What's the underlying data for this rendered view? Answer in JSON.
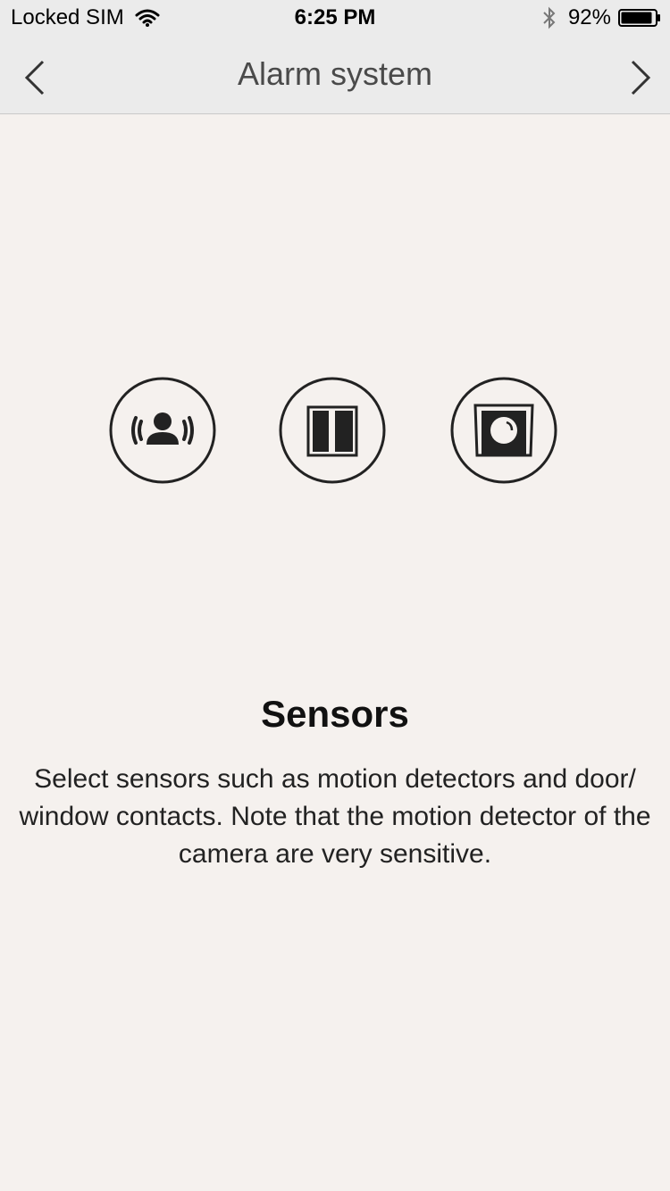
{
  "status_bar": {
    "carrier": "Locked SIM",
    "time": "6:25 PM",
    "battery_percent": "92%",
    "battery_level": 0.92,
    "icons": [
      "wifi-icon",
      "bluetooth-icon",
      "battery-icon"
    ]
  },
  "nav": {
    "title": "Alarm system",
    "back_icon": "chevron-left-icon",
    "forward_icon": "chevron-right-icon"
  },
  "sensor_icons": [
    {
      "name": "motion-detector-icon"
    },
    {
      "name": "door-window-contact-icon"
    },
    {
      "name": "camera-icon"
    }
  ],
  "content": {
    "heading": "Sensors",
    "description": "Select sensors such as motion detectors and door/ window contacts. Note that the motion detector of the camera are very sensitive."
  },
  "colors": {
    "background": "#f5f1ee",
    "bar_background": "#ebebeb",
    "icon_stroke": "#222222"
  }
}
